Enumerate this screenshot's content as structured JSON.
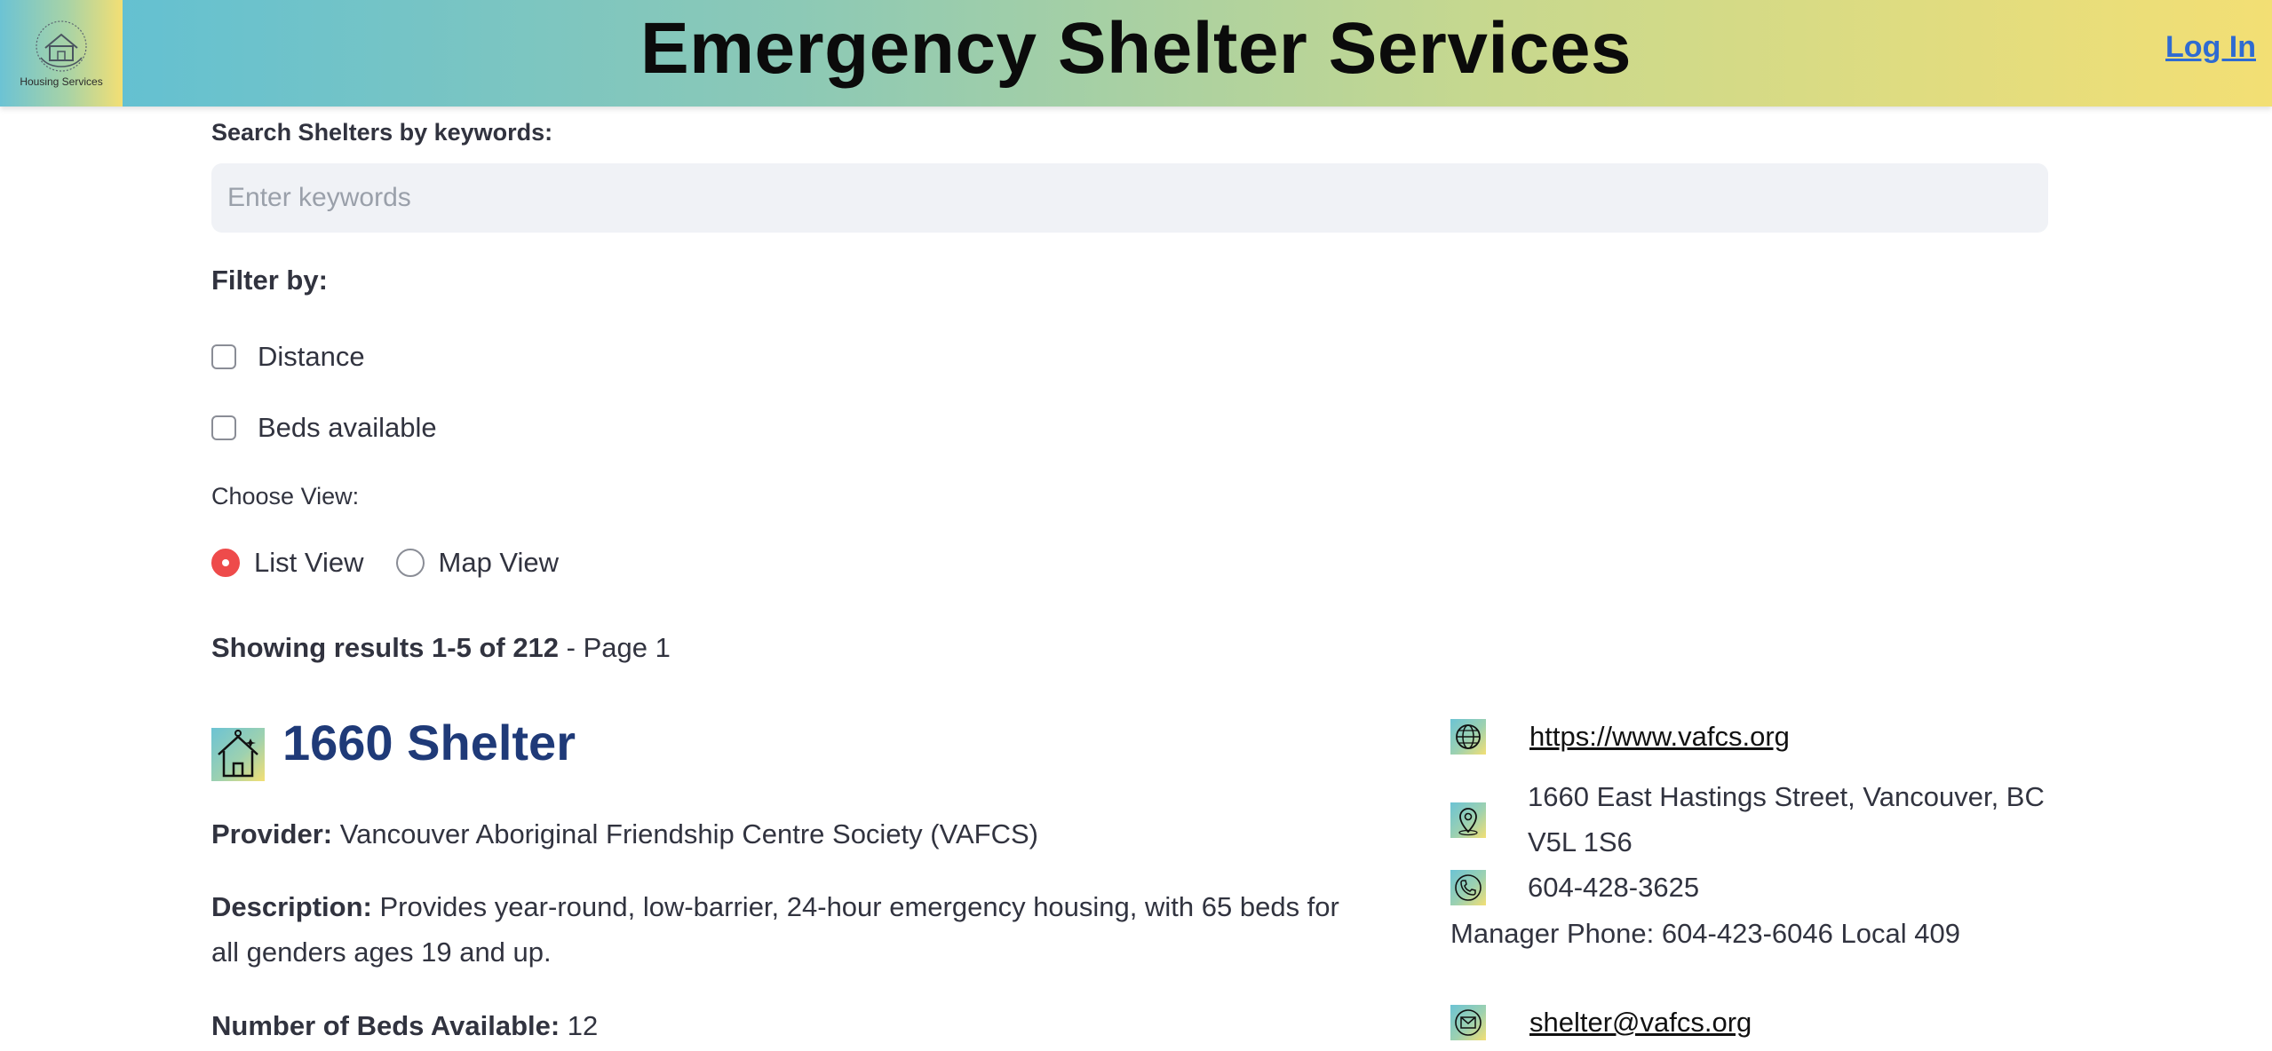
{
  "header": {
    "logo_text": "Housing Services",
    "title": "Emergency Shelter Services",
    "login_label": "Log In"
  },
  "search": {
    "label": "Search Shelters by keywords:",
    "placeholder": "Enter keywords",
    "value": ""
  },
  "filters": {
    "label": "Filter by:",
    "options": [
      {
        "label": "Distance",
        "checked": false
      },
      {
        "label": "Beds available",
        "checked": false
      }
    ]
  },
  "view": {
    "label": "Choose View:",
    "options": [
      {
        "label": "List View",
        "selected": true
      },
      {
        "label": "Map View",
        "selected": false
      }
    ]
  },
  "results": {
    "summary_bold": "Showing results 1-5 of 212",
    "summary_rest": " - Page 1"
  },
  "shelter": {
    "icon": "house-icon",
    "name": "1660 Shelter",
    "provider_label": "Provider:",
    "provider": " Vancouver Aboriginal Friendship Centre Society (VAFCS)",
    "description_label": "Description:",
    "description": " Provides year-round, low-barrier, 24-hour emergency housing, with 65 beds for all genders ages 19 and up.",
    "beds_label": "Number of Beds Available:",
    "beds": " 12",
    "website": "https://www.vafcs.org",
    "address_line1": "1660 East Hastings Street, Vancouver, BC",
    "address_line2": "V5L 1S6",
    "phone": "604-428-3625",
    "manager_phone": "Manager Phone: 604-423-6046 Local 409",
    "email": "shelter@vafcs.org"
  },
  "colors": {
    "header_gradient_start": "#5dbfd6",
    "header_gradient_end": "#f3df74",
    "title_link": "#1f3a78",
    "login_link": "#2f6bd1",
    "radio_selected": "#ee4b4b"
  }
}
